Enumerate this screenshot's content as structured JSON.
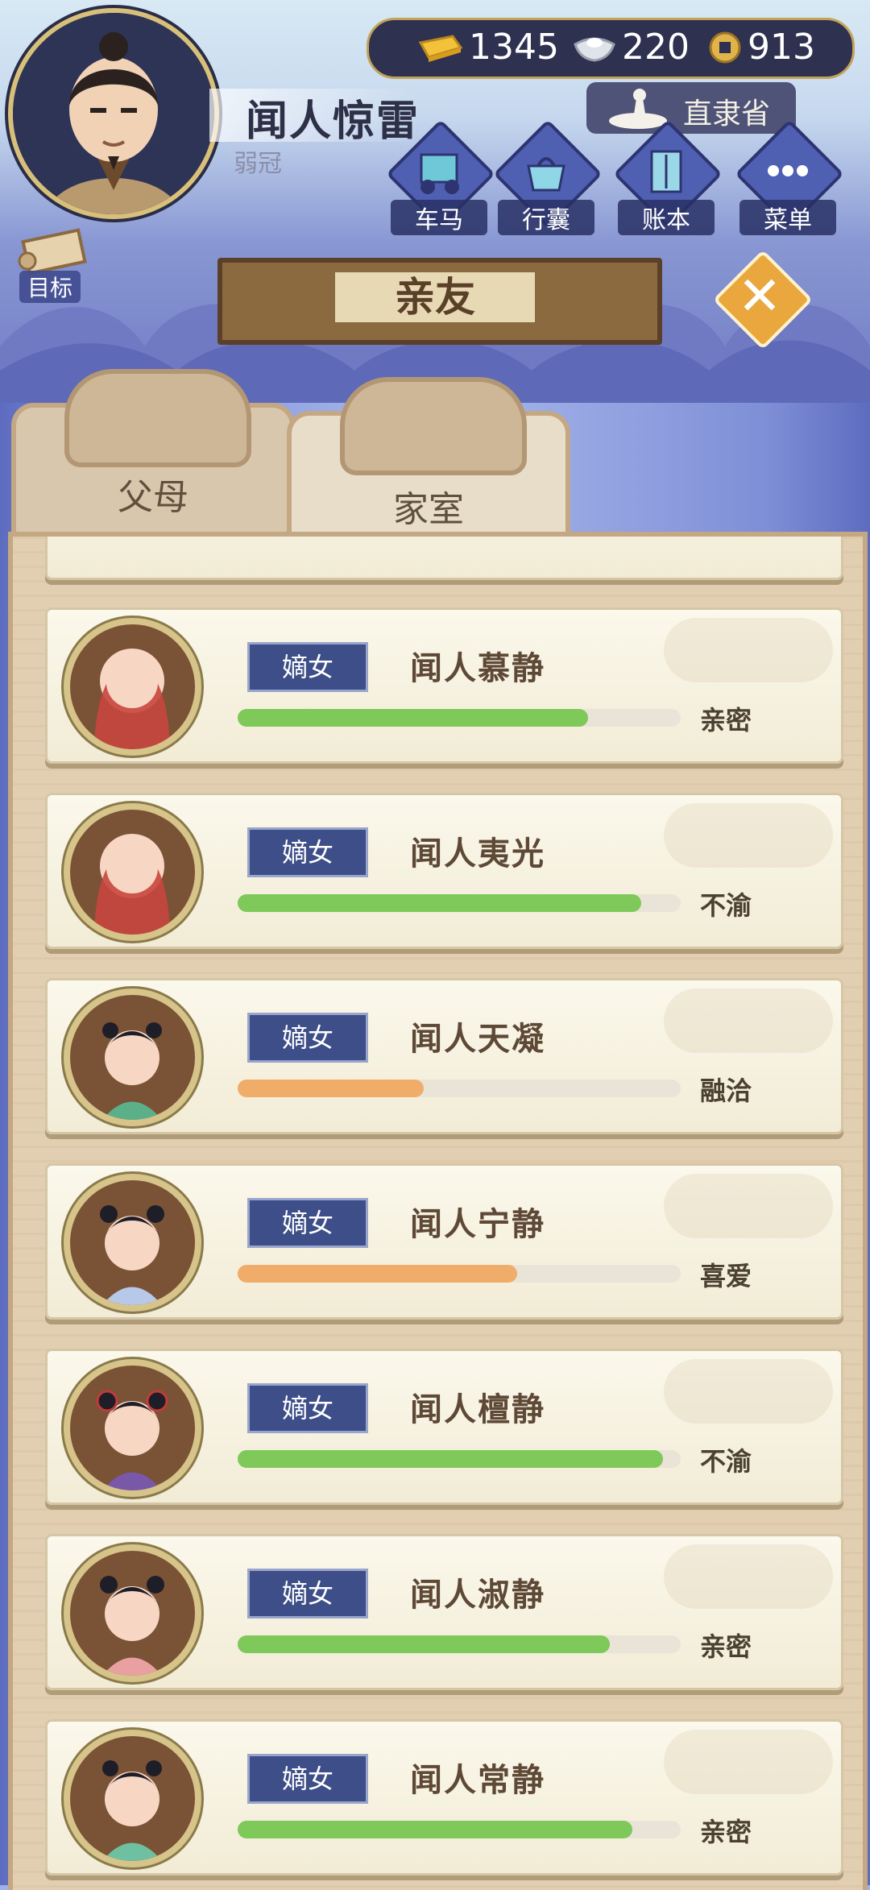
{
  "header": {
    "name": "闻人惊雷",
    "age": "弱冠",
    "province": "直隶省",
    "currency": {
      "gold": "1345",
      "silver": "220",
      "copper": "913"
    },
    "menu": [
      "车马",
      "行囊",
      "账本",
      "菜单"
    ],
    "goal": "目标"
  },
  "banner": {
    "title": "亲友"
  },
  "tabs": [
    {
      "label": "父母"
    },
    {
      "label": "家室"
    }
  ],
  "list": [
    {
      "rank": "嫡女",
      "name": "闻人慕静",
      "status": "亲密",
      "progress": 0.79,
      "color": "#7fc85a"
    },
    {
      "rank": "嫡女",
      "name": "闻人夷光",
      "status": "不渝",
      "progress": 0.91,
      "color": "#7fc85a"
    },
    {
      "rank": "嫡女",
      "name": "闻人天凝",
      "status": "融洽",
      "progress": 0.42,
      "color": "#f0ad6a"
    },
    {
      "rank": "嫡女",
      "name": "闻人宁静",
      "status": "喜爱",
      "progress": 0.63,
      "color": "#f0ad6a"
    },
    {
      "rank": "嫡女",
      "name": "闻人檀静",
      "status": "不渝",
      "progress": 0.96,
      "color": "#7fc85a"
    },
    {
      "rank": "嫡女",
      "name": "闻人淑静",
      "status": "亲密",
      "progress": 0.84,
      "color": "#7fc85a"
    },
    {
      "rank": "嫡女",
      "name": "闻人常静",
      "status": "亲密",
      "progress": 0.89,
      "color": "#7fc85a"
    }
  ]
}
